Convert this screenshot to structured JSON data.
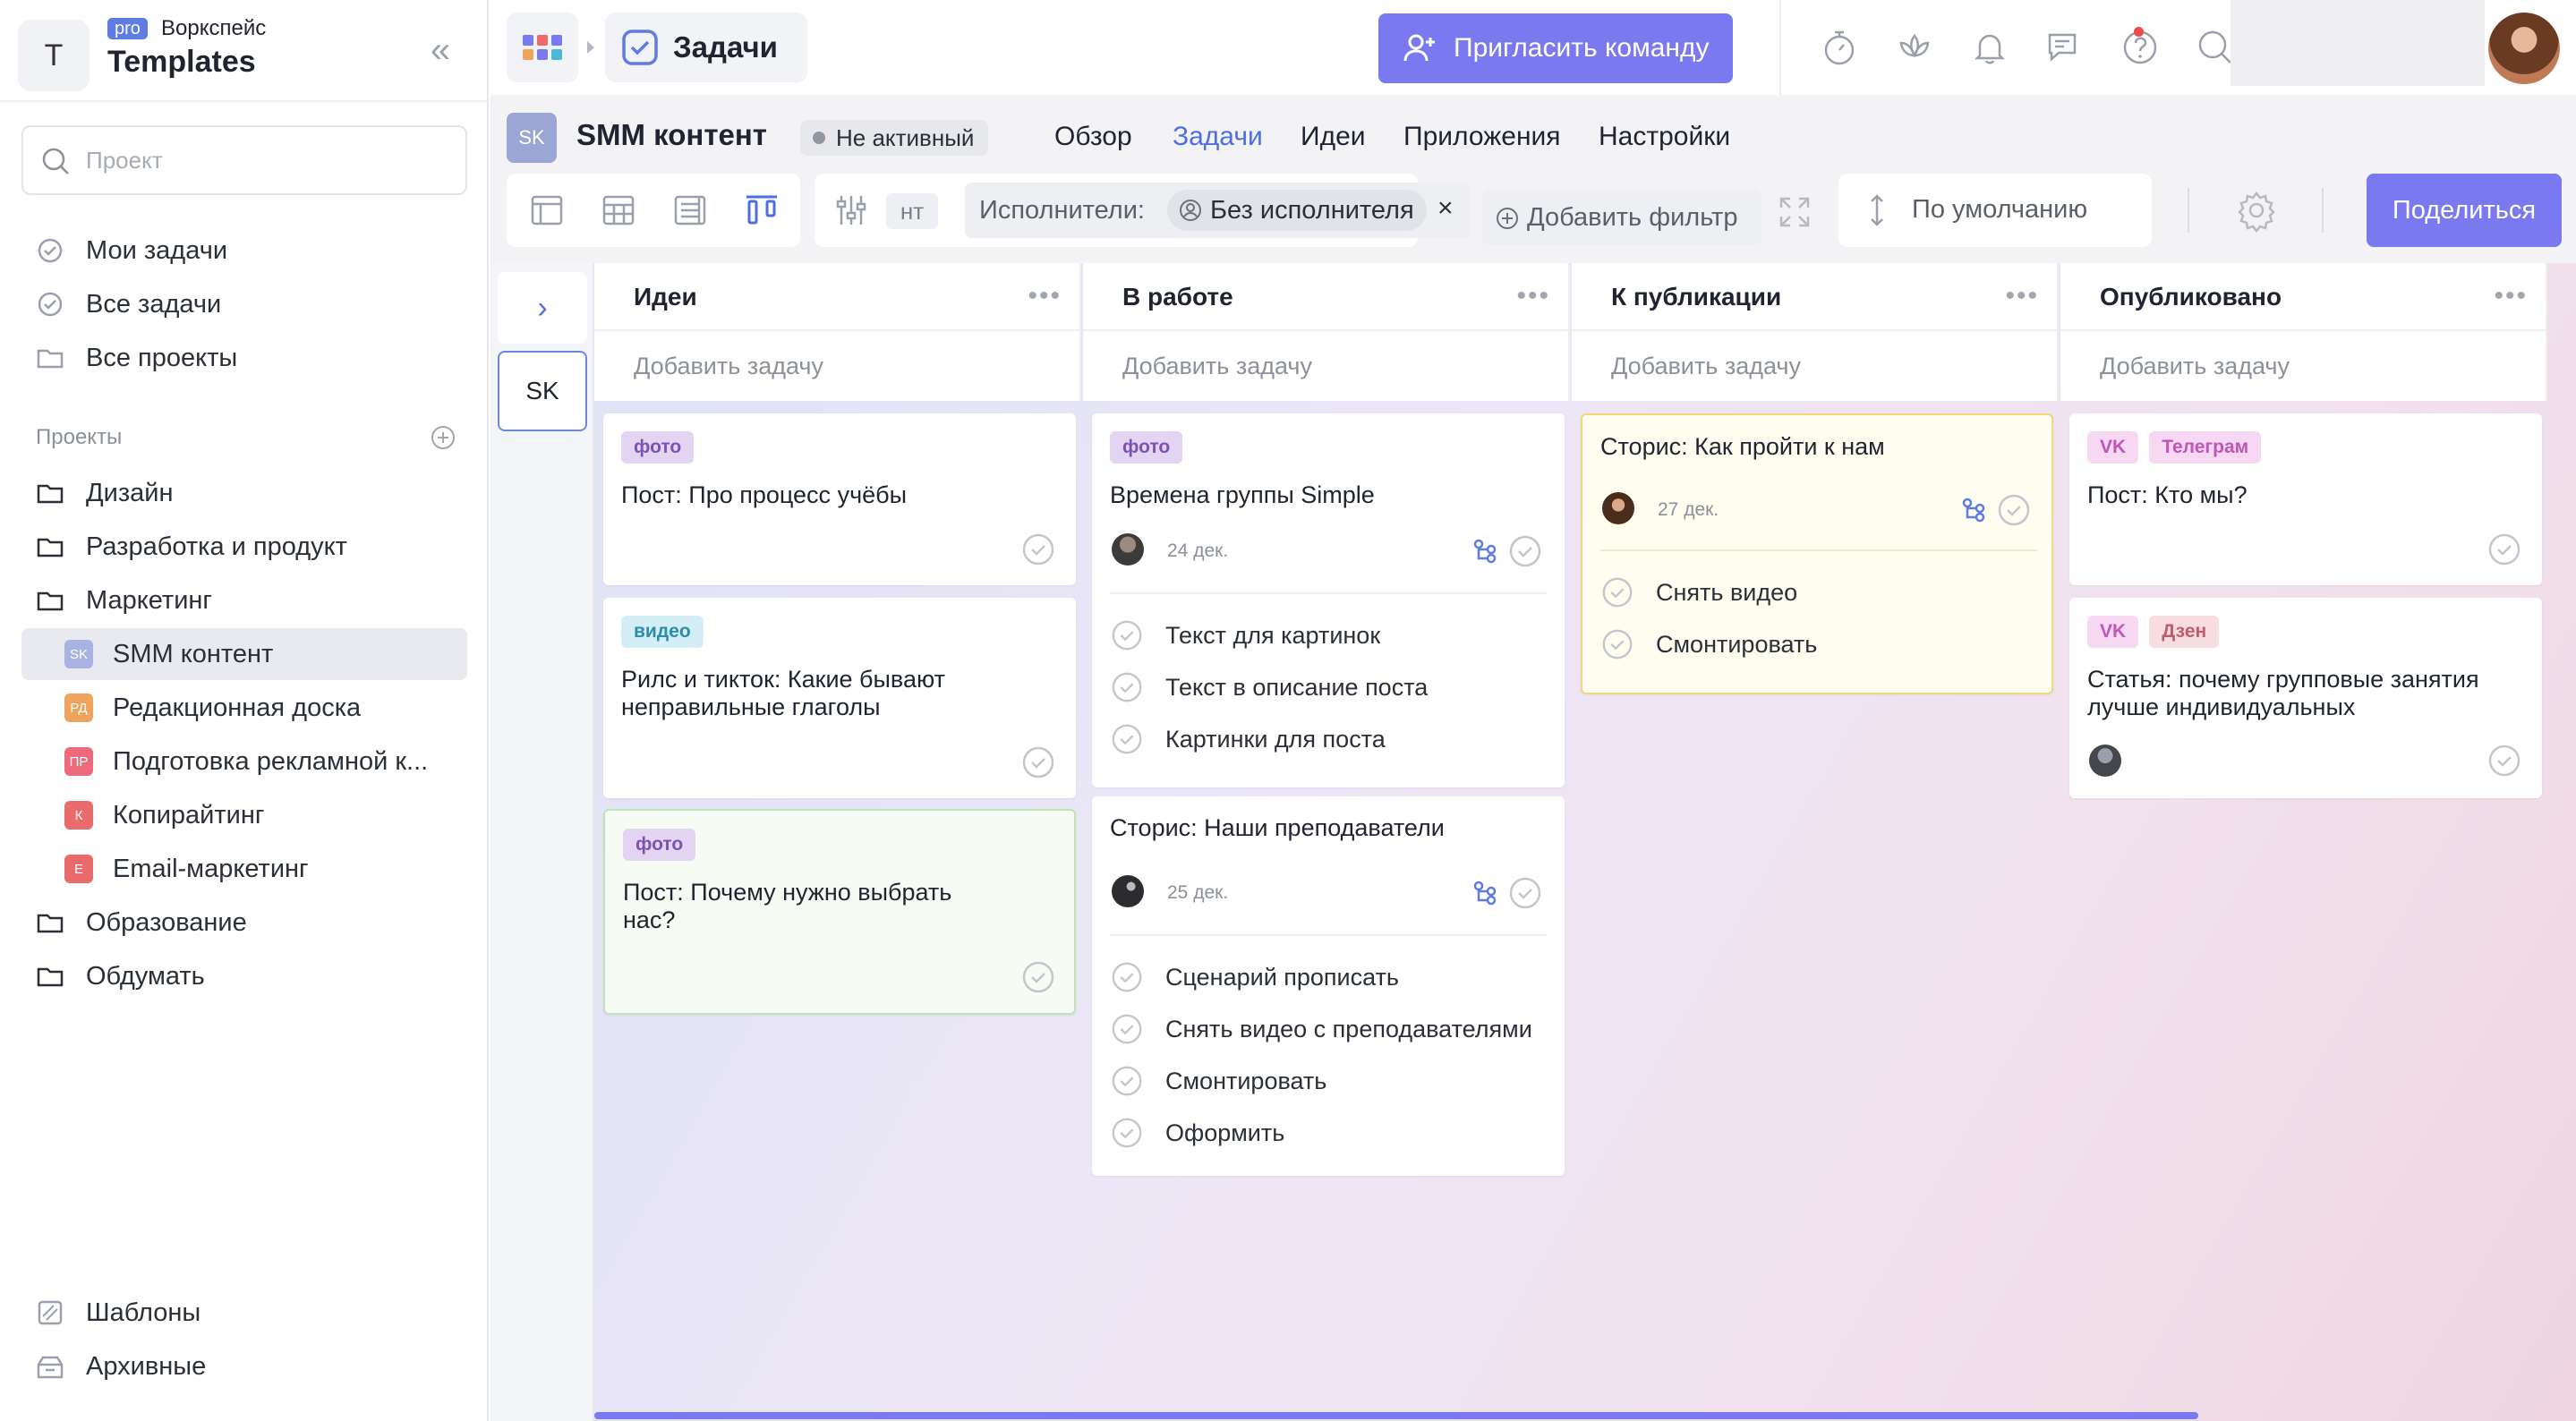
{
  "workspace": {
    "avatar_letter": "T",
    "plan_badge": "pro",
    "label": "Воркспейс",
    "name": "Templates"
  },
  "sidebar": {
    "search_placeholder": "Проект",
    "nav": [
      {
        "label": "Мои задачи",
        "icon": "my-tasks-icon"
      },
      {
        "label": "Все задачи",
        "icon": "all-tasks-icon"
      },
      {
        "label": "Все проекты",
        "icon": "all-projects-icon"
      }
    ],
    "projects_title": "Проекты",
    "projects": [
      {
        "label": "Дизайн",
        "type": "folder"
      },
      {
        "label": "Разработка и продукт",
        "type": "folder"
      },
      {
        "label": "Маркетинг",
        "type": "folder"
      },
      {
        "label": "SMM контент",
        "badge": "SK",
        "color": "#a9b2e0",
        "active": true
      },
      {
        "label": "Редакционная доска",
        "badge": "РД",
        "color": "#f0a35c"
      },
      {
        "label": "Подготовка рекламной к...",
        "badge": "ПР",
        "color": "#ec6a7c"
      },
      {
        "label": "Копирайтинг",
        "badge": "К",
        "color": "#ea6b6b"
      },
      {
        "label": "Email-маркетинг",
        "badge": "E",
        "color": "#ea6b6b"
      },
      {
        "label": "Образование",
        "type": "folder"
      },
      {
        "label": "Обдумать",
        "type": "folder"
      }
    ],
    "footer": [
      {
        "label": "Шаблоны",
        "icon": "templates-icon"
      },
      {
        "label": "Архивные",
        "icon": "archive-icon"
      }
    ]
  },
  "topbar": {
    "section_title": "Задачи",
    "invite_label": "Пригласить команду",
    "accent": "#7a79ef"
  },
  "project": {
    "badge": "SK",
    "name": "SMM контент",
    "status": "Не активный",
    "tabs": [
      {
        "label": "Обзор",
        "active": false
      },
      {
        "label": "Задачи",
        "active": true
      },
      {
        "label": "Идеи",
        "active": false
      },
      {
        "label": "Приложения",
        "active": false
      },
      {
        "label": "Настройки",
        "active": false
      }
    ]
  },
  "toolbar": {
    "filter_stub": "нт",
    "assignee_label": "Исполнители:",
    "assignee_value": "Без исполнителя",
    "remove_symbol": "×",
    "add_filter": "Добавить фильтр",
    "sort_label": "По умолчанию",
    "share_label": "Поделиться"
  },
  "board": {
    "collapsed_project": "SK",
    "add_task_label": "Добавить задачу",
    "columns": [
      {
        "title": "Идеи",
        "cards": [
          {
            "tags": [
              {
                "text": "фото",
                "bg": "#e3d5f2",
                "fg": "#7c52b5"
              }
            ],
            "title": "Пост: Про процесс учёбы"
          },
          {
            "tags": [
              {
                "text": "видео",
                "bg": "#d4eef5",
                "fg": "#2c8cb0"
              }
            ],
            "title": "Рилс и тикток: Какие бывают неправильные глаголы"
          },
          {
            "tags": [
              {
                "text": "фото",
                "bg": "#e3d5f2",
                "fg": "#7c52b5"
              }
            ],
            "title": "Пост: Почему нужно выбрать нас?"
          }
        ]
      },
      {
        "title": "В работе",
        "cards": [
          {
            "tags": [
              {
                "text": "фото",
                "bg": "#e3d5f2",
                "fg": "#7c52b5"
              }
            ],
            "title": "Времена группы Simple",
            "date": "24 дек.",
            "subtasks": [
              "Текст для картинок",
              "Текст в описание поста",
              "Картинки для поста"
            ]
          },
          {
            "title": "Сторис: Наши преподаватели",
            "date": "25 дек.",
            "subtasks": [
              "Сценарий прописать",
              "Снять видео с преподавателями",
              "Смонтировать",
              "Оформить"
            ]
          }
        ]
      },
      {
        "title": "К публикации",
        "cards": [
          {
            "title": "Сторис: Как пройти к нам",
            "date": "27 дек.",
            "subtasks": [
              "Снять видео",
              "Смонтировать"
            ]
          }
        ]
      },
      {
        "title": "Опубликовано",
        "cards": [
          {
            "tags": [
              {
                "text": "VK",
                "bg": "#f6d8f2",
                "fg": "#c056b6"
              },
              {
                "text": "Телеграм",
                "bg": "#f6d8f2",
                "fg": "#c056b6"
              }
            ],
            "title": "Пост: Кто мы?"
          },
          {
            "tags": [
              {
                "text": "VK",
                "bg": "#f6d8f2",
                "fg": "#c056b6"
              },
              {
                "text": "Дзен",
                "bg": "#f7dce0",
                "fg": "#c25b6c"
              }
            ],
            "title": "Статья: почему групповые занятия лучше индивидуальных"
          }
        ]
      }
    ]
  }
}
